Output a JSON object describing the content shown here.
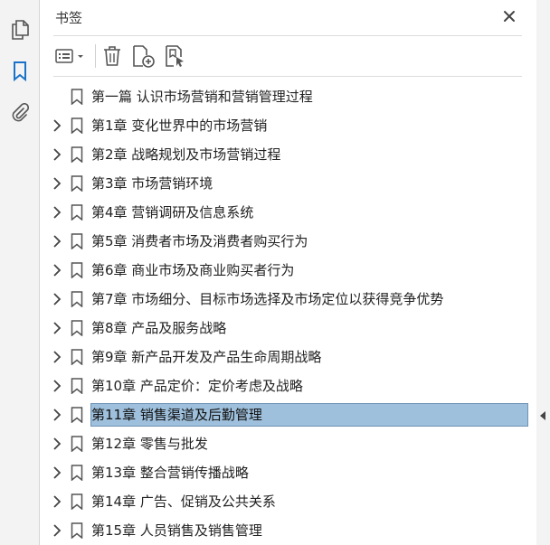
{
  "panel": {
    "title": "书签"
  },
  "toolbar": [
    {
      "name": "options-menu-button",
      "icon": "list-options-icon"
    },
    {
      "name": "delete-bookmark-button",
      "icon": "trash-icon"
    },
    {
      "name": "new-bookmark-button",
      "icon": "new-bookmark-icon"
    },
    {
      "name": "find-current-bookmark-button",
      "icon": "find-bookmark-icon"
    }
  ],
  "bookmarks": [
    {
      "label": "第一篇  认识市场营销和营销管理过程",
      "expandable": false,
      "selected": false
    },
    {
      "label": "第1章  变化世界中的市场营销",
      "expandable": true,
      "selected": false
    },
    {
      "label": "第2章 战略规划及市场营销过程",
      "expandable": true,
      "selected": false
    },
    {
      "label": "第3章  市场营销环境",
      "expandable": true,
      "selected": false
    },
    {
      "label": "第4章 营销调研及信息系统",
      "expandable": true,
      "selected": false
    },
    {
      "label": "第5章  消费者市场及消费者购买行为",
      "expandable": true,
      "selected": false
    },
    {
      "label": "第6章  商业市场及商业购买者行为",
      "expandable": true,
      "selected": false
    },
    {
      "label": "第7章  市场细分、目标市场选择及市场定位以获得竞争优势",
      "expandable": true,
      "selected": false
    },
    {
      "label": "第8章  产品及服务战略",
      "expandable": true,
      "selected": false
    },
    {
      "label": "第9章  新产品开发及产品生命周期战略",
      "expandable": true,
      "selected": false
    },
    {
      "label": "第10章  产品定价：定价考虑及战略",
      "expandable": true,
      "selected": false
    },
    {
      "label": "第11章  销售渠道及后勤管理",
      "expandable": true,
      "selected": true
    },
    {
      "label": "第12章  零售与批发",
      "expandable": true,
      "selected": false
    },
    {
      "label": "第13章  整合营销传播战略",
      "expandable": true,
      "selected": false
    },
    {
      "label": "第14章  广告、促销及公共关系",
      "expandable": true,
      "selected": false
    },
    {
      "label": "第15章  人员销售及销售管理",
      "expandable": true,
      "selected": false
    }
  ],
  "colors": {
    "accent": "#1a73c8",
    "selection": "#9ec0dc",
    "icon": "#555555"
  }
}
